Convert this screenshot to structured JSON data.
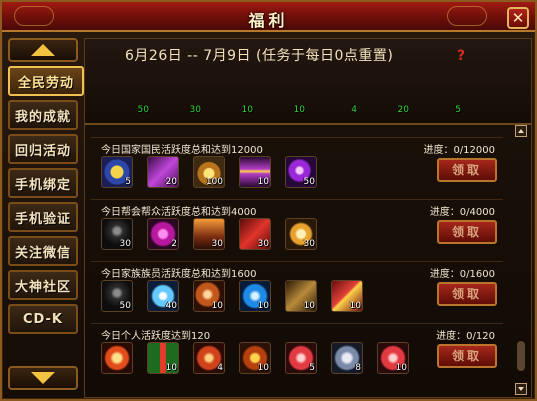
{
  "window": {
    "title": "福利",
    "close_symbol": "✕"
  },
  "sidebar": {
    "items": [
      {
        "label": "全民劳动",
        "active": true
      },
      {
        "label": "我的成就",
        "active": false
      },
      {
        "label": "回归活动",
        "active": false
      },
      {
        "label": "手机绑定",
        "active": false
      },
      {
        "label": "手机验证",
        "active": false
      },
      {
        "label": "关注微信",
        "active": false
      },
      {
        "label": "大神社区",
        "active": false
      },
      {
        "label": "CD-K",
        "active": false
      }
    ]
  },
  "header": {
    "date_range": "6月26日 -- 7月9日 (任务于每日0点重置)",
    "help": "?",
    "rewards": [
      {
        "icon": "dark-helmet-icon",
        "count": "50"
      },
      {
        "icon": "dark-armor-icon",
        "count": "30"
      },
      {
        "icon": "red-envelope-icon",
        "count": "10"
      },
      {
        "icon": "gold-seal-icon",
        "count": "10"
      },
      {
        "icon": "fire-orb-icon",
        "count": "4"
      },
      {
        "icon": "ice-feather-icon",
        "count": "20"
      },
      {
        "icon": "scroll-icon",
        "count": "5"
      }
    ]
  },
  "tasks": [
    {
      "desc": "今日国家国民活跃度总和达到12000",
      "progress": "进度：0/12000",
      "claim": "领取",
      "items": [
        {
          "icon": "blue-scroll-icon",
          "count": "5"
        },
        {
          "icon": "purple-crystal-icon",
          "count": "20"
        },
        {
          "icon": "gold-coin-icon",
          "count": "100"
        },
        {
          "icon": "purple-book-icon",
          "count": "10"
        },
        {
          "icon": "purple-orb-icon",
          "count": "50"
        }
      ]
    },
    {
      "desc": "今日帮会帮众活跃度总和达到4000",
      "progress": "进度：0/4000",
      "claim": "领取",
      "items": [
        {
          "icon": "dark-beast-icon",
          "count": "30"
        },
        {
          "icon": "rose-gem-icon",
          "count": "2"
        },
        {
          "icon": "sunset-scene-icon",
          "count": "30"
        },
        {
          "icon": "red-card-icon",
          "count": "30"
        },
        {
          "icon": "golden-egg-icon",
          "count": "30"
        }
      ]
    },
    {
      "desc": "今日家族族员活跃度总和达到1600",
      "progress": "进度：0/1600",
      "claim": "领取",
      "items": [
        {
          "icon": "dark-helmet-icon",
          "count": "50"
        },
        {
          "icon": "ice-feather-icon",
          "count": "40"
        },
        {
          "icon": "amber-stone-icon",
          "count": "10"
        },
        {
          "icon": "blue-diamond-icon",
          "count": "10"
        },
        {
          "icon": "bronze-weapon-icon",
          "count": "10"
        },
        {
          "icon": "red-envelope-icon",
          "count": "10"
        }
      ]
    },
    {
      "desc": "今日个人活跃度达到120",
      "progress": "进度：0/120",
      "claim": "领取",
      "items": [
        {
          "icon": "fire-orb-icon",
          "count": ""
        },
        {
          "icon": "gift-box-icon",
          "count": "10"
        },
        {
          "icon": "ember-stone-icon",
          "count": "4"
        },
        {
          "icon": "gold-seal-icon",
          "count": "10"
        },
        {
          "icon": "red-gem-icon",
          "count": "5"
        },
        {
          "icon": "ice-shard-icon",
          "count": "8"
        },
        {
          "icon": "pink-orb-icon",
          "count": "10"
        }
      ]
    }
  ]
}
